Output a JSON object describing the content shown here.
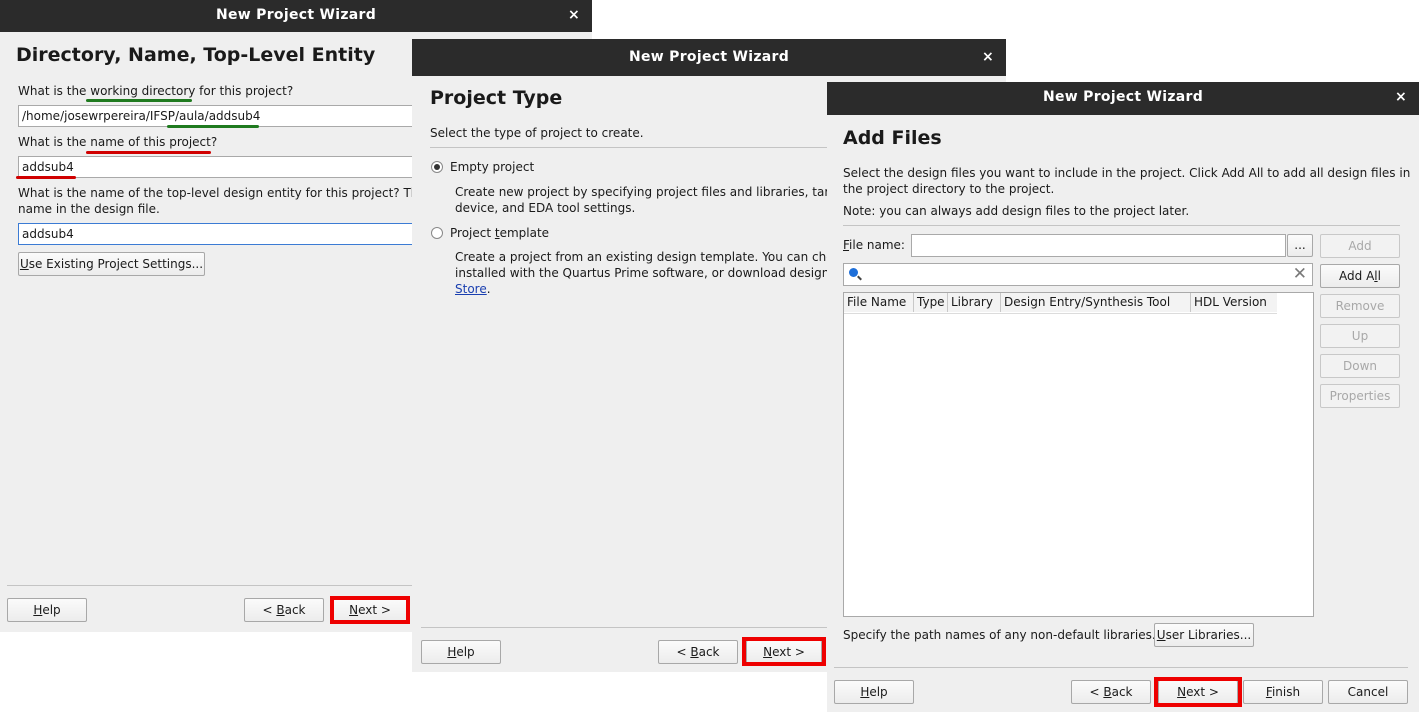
{
  "colors": {
    "title_bar": "#2b2b2b",
    "highlight": "#ee0000",
    "underline_green": "#1f7a1f",
    "underline_red": "#d00000"
  },
  "win1": {
    "title": "New Project Wizard",
    "close": "×",
    "heading": "Directory, Name, Top-Level Entity",
    "q1_pre": "What is the ",
    "q1_underlined": "working directory",
    "q1_post": " for this project?",
    "dir_value": "/home/josewrpereira/IFSP/aula/addsub4",
    "q2_pre": "What is the ",
    "q2_underlined": "name of this project",
    "q2_post": "?",
    "name_value": "addsub4",
    "q3_line1": "What is the name of the top-level design entity for this project? This",
    "q3_line2": "name in the design file.",
    "top_value": "addsub4",
    "use_existing_u": "U",
    "use_existing_rest": "se Existing Project Settings...",
    "help_u": "H",
    "help_rest": "elp",
    "back_pre": "< ",
    "back_u": "B",
    "back_rest": "ack",
    "next_u": "N",
    "next_rest": "ext >"
  },
  "win2": {
    "title": "New Project Wizard",
    "close": "×",
    "heading": "Project Type",
    "subtitle": "Select the type of project to create.",
    "opt1_label": "Empty project",
    "opt1_desc1": "Create new project by specifying project files and libraries, targ",
    "opt1_desc2": "device, and EDA tool settings.",
    "opt2_pre": "Project ",
    "opt2_u": "t",
    "opt2_rest": "emplate",
    "opt2_desc1": "Create a project from an existing design template. You can cho",
    "opt2_desc2": "installed with the Quartus Prime software, or download design t",
    "opt2_link": "Store",
    "opt2_after": ".",
    "help_u": "H",
    "help_rest": "elp",
    "back_pre": "< ",
    "back_u": "B",
    "back_rest": "ack",
    "next_u": "N",
    "next_rest": "ext >"
  },
  "win3": {
    "title": "New Project Wizard",
    "close": "×",
    "heading": "Add Files",
    "desc1": "Select the design files you want to include in the project. Click Add All to add all design files in",
    "desc2": "the project directory to the project.",
    "note": "Note: you can always add design files to the project later.",
    "file_label_u": "F",
    "file_label_rest": "ile name:",
    "file_value": "",
    "browse": "...",
    "add": "Add",
    "add_all_pre": "Add A",
    "add_all_u": "l",
    "add_all_rest": "l",
    "remove": "Remove",
    "up": "Up",
    "down": "Down",
    "properties": "Properties",
    "search_value": "",
    "columns": [
      "File Name",
      "Type",
      "Library",
      "Design Entry/Synthesis Tool",
      "HDL Version"
    ],
    "libs_text": "Specify the path names of any non-default libraries.",
    "user_libs_u": "U",
    "user_libs_rest": "ser Libraries...",
    "help_u": "H",
    "help_rest": "elp",
    "back_pre": "< ",
    "back_u": "B",
    "back_rest": "ack",
    "next_u": "N",
    "next_rest": "ext >",
    "finish_u": "F",
    "finish_rest": "inish",
    "cancel": "Cancel"
  }
}
